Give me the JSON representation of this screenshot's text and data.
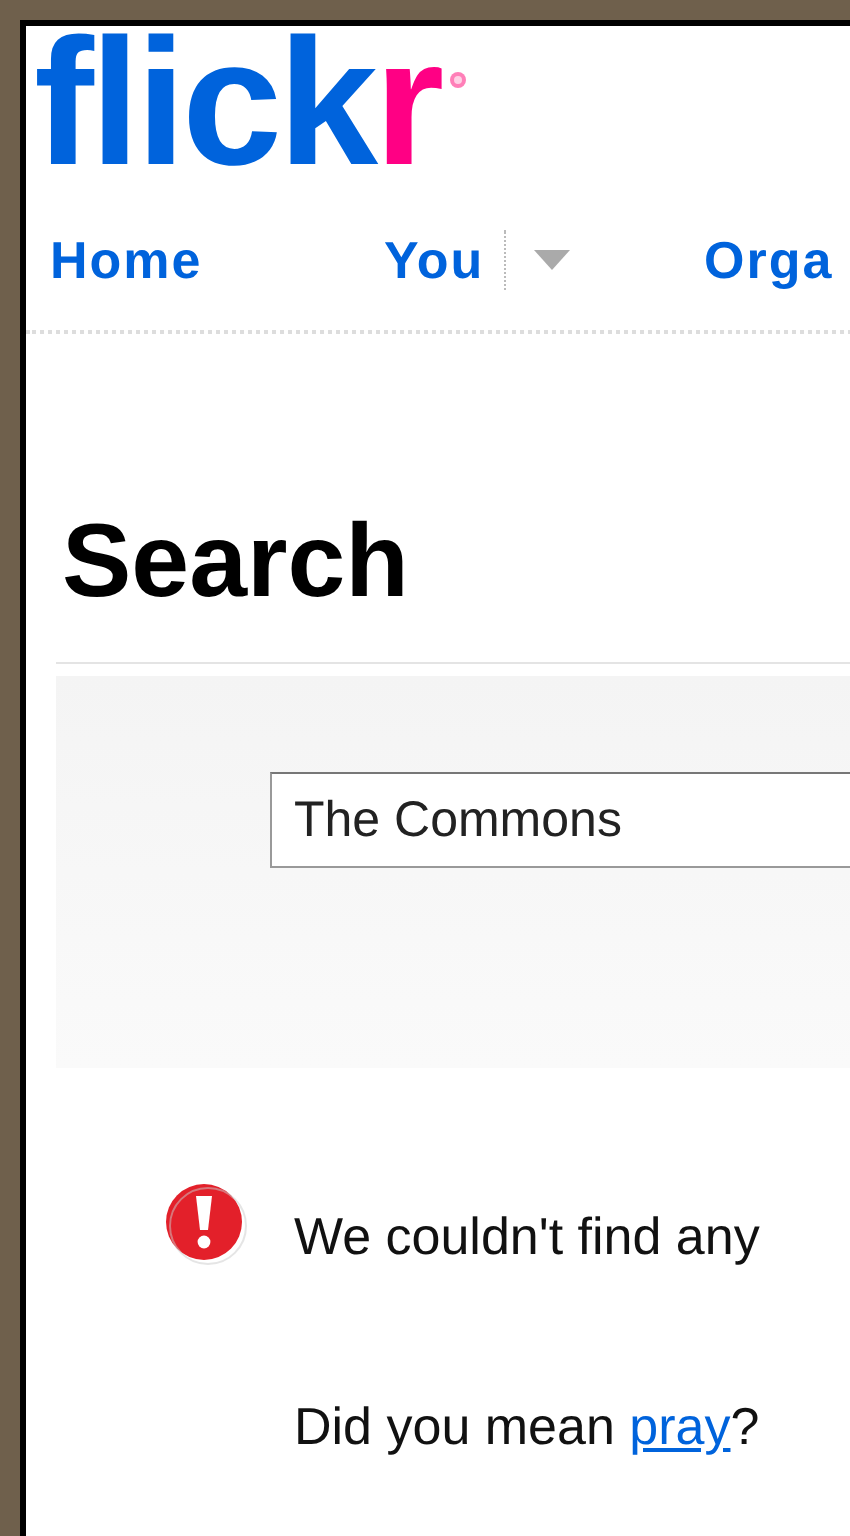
{
  "logo": {
    "parts": [
      {
        "text": "flick",
        "color": "#0063dc"
      },
      {
        "text": "r",
        "color": "#ff0084"
      }
    ]
  },
  "nav": {
    "items": [
      {
        "label": "Home",
        "has_menu": false
      },
      {
        "label": "You",
        "has_menu": true
      },
      {
        "label": "Orga",
        "has_menu": false
      }
    ]
  },
  "page_title": "Search",
  "search": {
    "value": "The Commons"
  },
  "error": {
    "message": "We couldn't find any"
  },
  "suggestion": {
    "prefix": "Did you mean",
    "link": "pray",
    "suffix": "?"
  }
}
